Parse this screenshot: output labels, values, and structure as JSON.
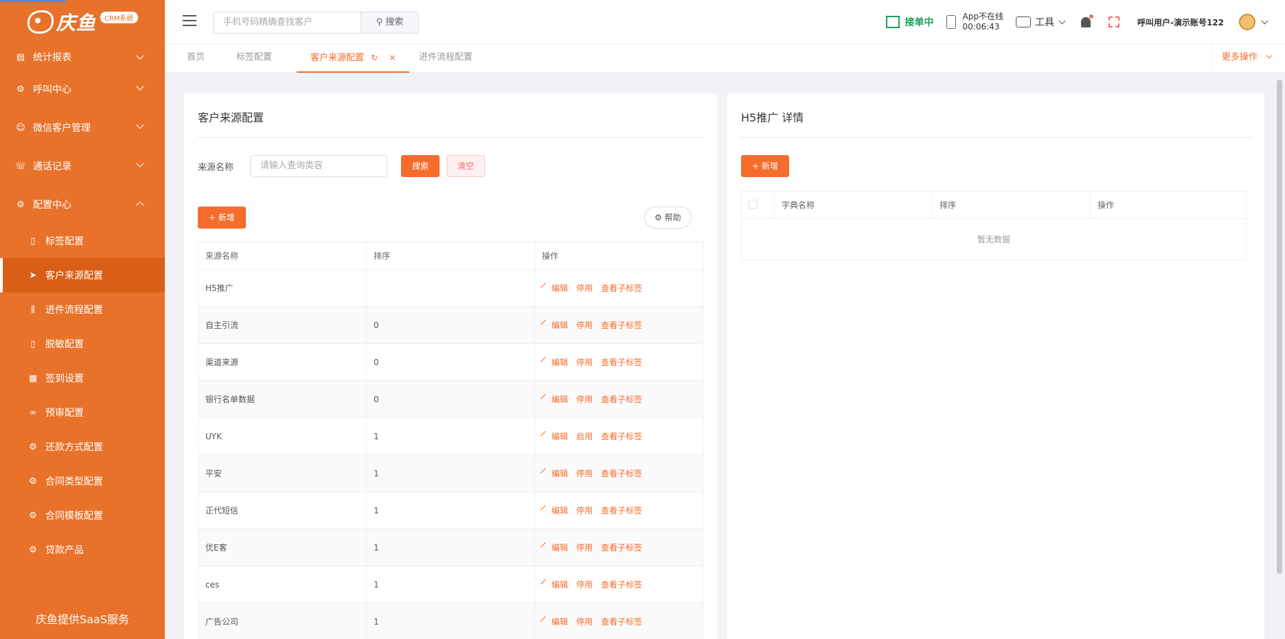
{
  "sidebar": {
    "brand": "庆鱼",
    "crm_badge": "CRM系统",
    "menus": [
      {
        "label": "统计报表",
        "icon": "table-icon"
      },
      {
        "label": "呼叫中心",
        "icon": "gear-icon"
      },
      {
        "label": "微信客户管理",
        "icon": "user-icon"
      },
      {
        "label": "通话记录",
        "icon": "phone-icon"
      },
      {
        "label": "配置中心",
        "icon": "gear-icon"
      }
    ],
    "subitems": [
      {
        "label": "标签配置",
        "icon": "document-icon"
      },
      {
        "label": "客户来源配置",
        "icon": "send-icon"
      },
      {
        "label": "进件流程配置",
        "icon": "sliders-icon"
      },
      {
        "label": "脱敏配置",
        "icon": "document-icon"
      },
      {
        "label": "签到设置",
        "icon": "grid-icon"
      },
      {
        "label": "预审配置",
        "icon": "glasses-icon"
      },
      {
        "label": "还款方式配置",
        "icon": "gear-icon"
      },
      {
        "label": "合同类型配置",
        "icon": "gear-icon"
      },
      {
        "label": "合同模板配置",
        "icon": "gear-icon"
      },
      {
        "label": "贷款产品",
        "icon": "gear-icon"
      }
    ],
    "footer": "庆鱼提供SaaS服务"
  },
  "header": {
    "search_placeholder": "手机号码精确查找客户",
    "search_button": "搜索",
    "take_order": "接单中",
    "app_status": "App不在线",
    "app_timer": "00:06:43",
    "tools": "工具",
    "user_name": "呼叫用户-演示账号122"
  },
  "tabs": {
    "items": [
      "首页",
      "标签配置",
      "客户来源配置",
      "进件流程配置"
    ],
    "more": "更多操作"
  },
  "left_panel": {
    "title": "客户来源配置",
    "filter_label": "来源名称",
    "filter_placeholder": "请输入查询类容",
    "search": "搜索",
    "clear": "清空",
    "add": "新增",
    "help": "帮助",
    "columns": [
      "来源名称",
      "排序",
      "操作"
    ],
    "rows": [
      {
        "name": "H5推广",
        "order": "",
        "toggle": "停用"
      },
      {
        "name": "自主引流",
        "order": "0",
        "toggle": "停用"
      },
      {
        "name": "渠道来源",
        "order": "0",
        "toggle": "停用"
      },
      {
        "name": "银行名单数据",
        "order": "0",
        "toggle": "停用"
      },
      {
        "name": "UYK",
        "order": "1",
        "toggle": "启用"
      },
      {
        "name": "平安",
        "order": "1",
        "toggle": "停用"
      },
      {
        "name": "正代短信",
        "order": "1",
        "toggle": "停用"
      },
      {
        "name": "优E客",
        "order": "1",
        "toggle": "停用"
      },
      {
        "name": "ces",
        "order": "1",
        "toggle": "停用"
      },
      {
        "name": "广告公司",
        "order": "1",
        "toggle": "停用"
      }
    ],
    "op_edit": "编辑",
    "op_view": "查看子标签"
  },
  "right_panel": {
    "title": "H5推广 详情",
    "add": "新增",
    "columns": [
      "字典名称",
      "排序",
      "操作"
    ],
    "empty": "暂无数据"
  },
  "colors": {
    "accent": "#f56c2c",
    "sidebar": "#e8722a",
    "active": "#d85f15"
  }
}
